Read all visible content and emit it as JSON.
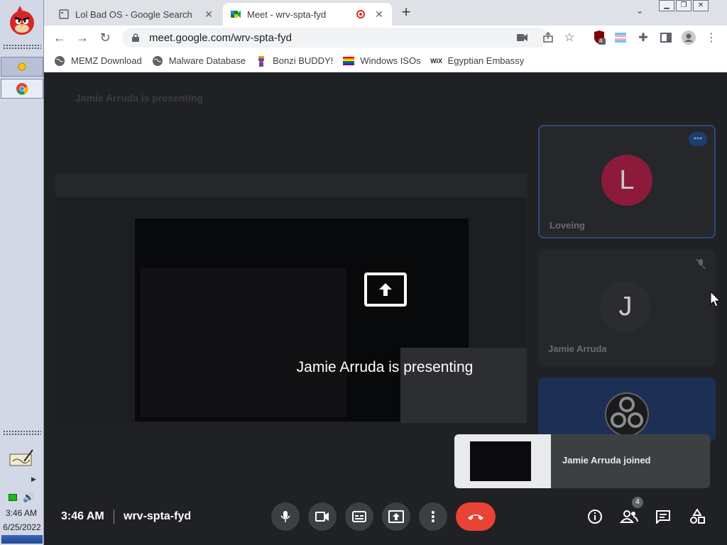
{
  "taskbar": {
    "time": "3:46 AM",
    "date": "6/25/2022"
  },
  "browser": {
    "tabs": [
      {
        "label": "Lol Bad OS - Google Search",
        "icon": "document-icon"
      },
      {
        "label": "Meet - wrv-spta-fyd",
        "icon": "meet-icon",
        "recording": true
      }
    ],
    "url": "meet.google.com/wrv-spta-fyd",
    "extension_badge": "4",
    "bookmarks": [
      {
        "label": "MEMZ Download",
        "icon": "globe-icon"
      },
      {
        "label": "Malware Database",
        "icon": "globe-icon"
      },
      {
        "label": "Bonzi BUDDY!",
        "icon": "bonzi-icon"
      },
      {
        "label": "Windows ISOs",
        "icon": "rainbow-flag-icon"
      },
      {
        "label": "Egyptian Embassy",
        "icon": "wix-icon"
      }
    ]
  },
  "meet": {
    "header": "Jamie Arruda is presenting",
    "presenting_text": "Jamie Arruda is presenting",
    "participants": [
      {
        "name": "Loveing",
        "initial": "L",
        "color": "#8c1b3b"
      },
      {
        "name": "Jamie Arruda",
        "initial": "J",
        "color": "#2a2c30"
      },
      {
        "name": "",
        "initial": "",
        "color": "#1e2f55"
      }
    ],
    "toast": "Jamie Arruda joined",
    "time": "3:46 AM",
    "meeting_code": "wrv-spta-fyd",
    "people_count": "4",
    "accent_end_call": "#ea4335"
  }
}
